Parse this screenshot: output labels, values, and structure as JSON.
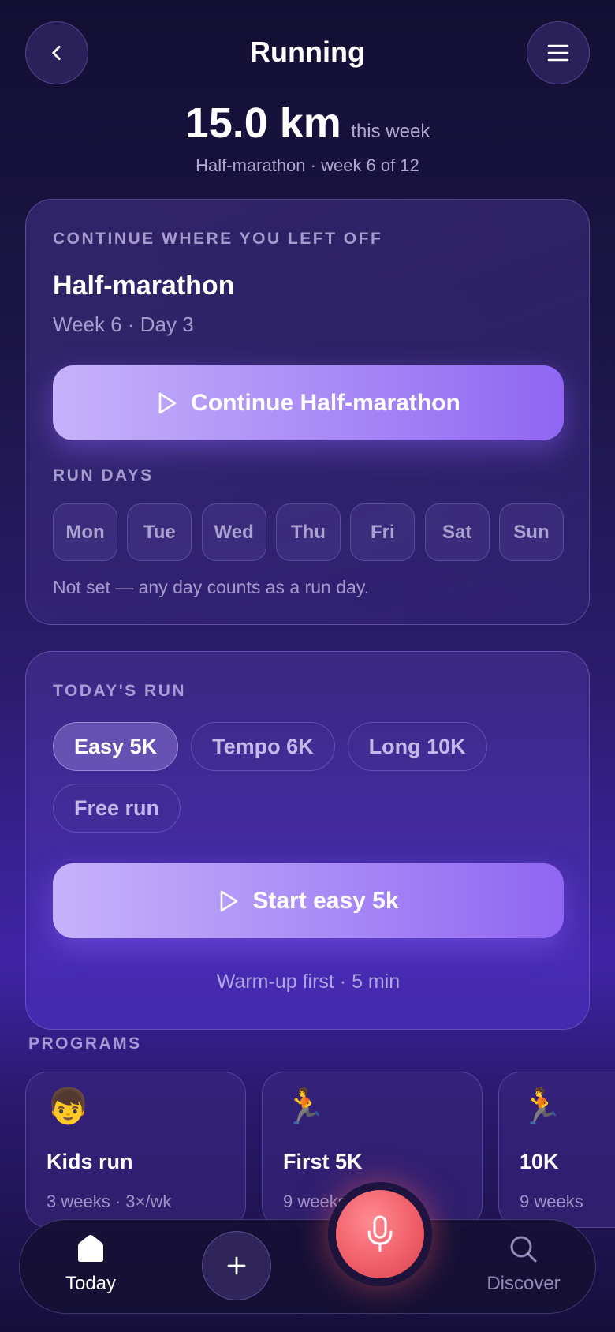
{
  "header": {
    "back_icon": "chevron-left-icon",
    "title": "Running",
    "menu_icon": "hamburger-menu-icon"
  },
  "summary": {
    "distance": "15.0 km",
    "period": "this week",
    "plan": "Half-marathon · week 6 of 12"
  },
  "continue_card": {
    "label": "CONTINUE WHERE YOU LEFT OFF",
    "program": "Half-marathon",
    "progress": "Week 6 · Day 3",
    "cta_label": "Continue Half-marathon",
    "run_days_label": "RUN DAYS",
    "days": [
      "Mon",
      "Tue",
      "Wed",
      "Thu",
      "Fri",
      "Sat",
      "Sun"
    ],
    "run_days_note": "Not set — any day counts as a run day."
  },
  "todays_run": {
    "label": "TODAY'S RUN",
    "options": [
      "Easy 5K",
      "Tempo 6K",
      "Long 10K",
      "Free run"
    ],
    "selected": "Easy 5K",
    "cta_label": "Start easy 5k",
    "note": "Warm-up first · 5 min"
  },
  "programs": {
    "label": "PROGRAMS",
    "items": [
      {
        "emoji": "👦",
        "name": "Kids run",
        "meta": "3 weeks · 3×/wk"
      },
      {
        "emoji": "🏃",
        "name": "First 5K",
        "meta": "9 weeks"
      },
      {
        "emoji": "🏃",
        "name": "10K",
        "meta": "9 weeks"
      }
    ]
  },
  "nav": {
    "today_label": "Today",
    "discover_label": "Discover"
  },
  "colors": {
    "accent_start": "#c6b2fb",
    "accent_end": "#8f66f2",
    "mic_button": "#f0606a"
  }
}
